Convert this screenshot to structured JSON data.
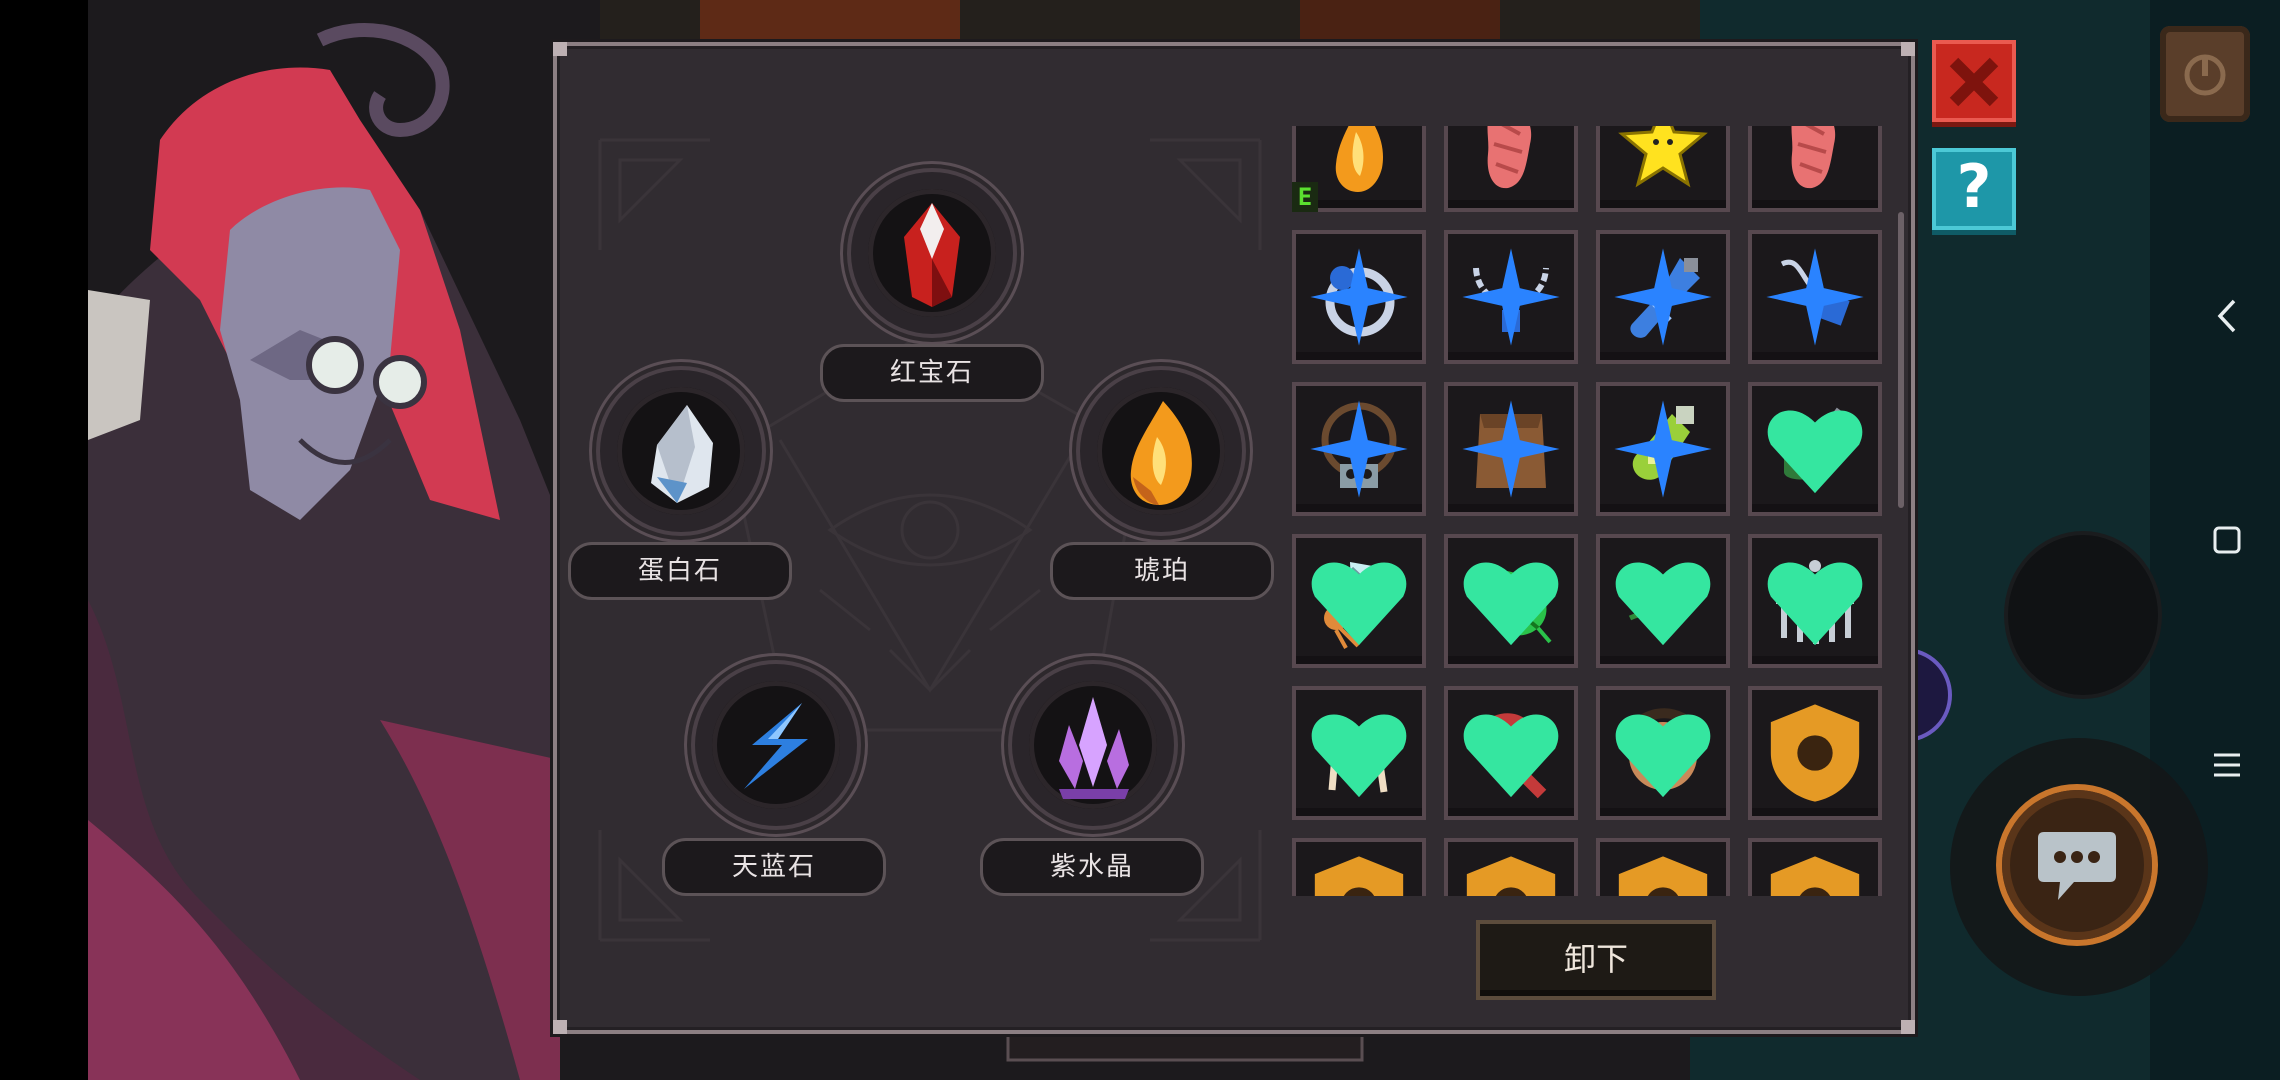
{
  "gem_sockets": [
    {
      "id": "ruby",
      "label": "红宝石",
      "color": "#c8211e"
    },
    {
      "id": "opal",
      "label": "蛋白石",
      "color": "#dfe6ee"
    },
    {
      "id": "amber",
      "label": "琥珀",
      "color": "#f39a1c"
    },
    {
      "id": "sapphire",
      "label": "天蓝石",
      "color": "#2d7fe0"
    },
    {
      "id": "amethyst",
      "label": "紫水晶",
      "color": "#b86ee0"
    }
  ],
  "inventory": {
    "items": [
      {
        "icon": "amber-gem-icon",
        "badge": "equipped",
        "badge_text": "E"
      },
      {
        "icon": "red-meat-icon",
        "badge": "none"
      },
      {
        "icon": "yellow-star-icon",
        "badge": "none"
      },
      {
        "icon": "red-meat-icon",
        "badge": "none"
      },
      {
        "icon": "blue-ring-icon",
        "badge": "sparkle"
      },
      {
        "icon": "silver-necklace-icon",
        "badge": "sparkle"
      },
      {
        "icon": "blue-flask-icon",
        "badge": "sparkle"
      },
      {
        "icon": "blue-pendant-icon",
        "badge": "sparkle"
      },
      {
        "icon": "skull-amulet-icon",
        "badge": "sparkle"
      },
      {
        "icon": "leather-pouch-icon",
        "badge": "sparkle"
      },
      {
        "icon": "green-bottle-icon",
        "badge": "sparkle"
      },
      {
        "icon": "green-pipe-icon",
        "badge": "heart"
      },
      {
        "icon": "feather-charm-icon",
        "badge": "heart"
      },
      {
        "icon": "green-leaf-icon",
        "badge": "heart"
      },
      {
        "icon": "green-herb-icon",
        "badge": "heart"
      },
      {
        "icon": "steel-helmet-icon",
        "badge": "heart"
      },
      {
        "icon": "bone-icon",
        "badge": "heart"
      },
      {
        "icon": "red-club-icon",
        "badge": "heart"
      },
      {
        "icon": "masked-face-icon",
        "badge": "heart"
      },
      {
        "icon": "bread-icon",
        "badge": "shield"
      },
      {
        "icon": "grey-orb-icon",
        "badge": "shield"
      },
      {
        "icon": "cyan-relic-icon",
        "badge": "shield"
      },
      {
        "icon": "red-relic-icon",
        "badge": "shield"
      },
      {
        "icon": "dark-relic-icon",
        "badge": "shield"
      }
    ]
  },
  "buttons": {
    "unload_label": "卸下",
    "help_label": "?"
  },
  "colors": {
    "panel": "#312c31",
    "close": "#c8281f",
    "help": "#1e97a8",
    "heart": "#35e6a0",
    "sparkle": "#2a83ff",
    "shield": "#e59a25",
    "equipped": "#5be02f"
  }
}
